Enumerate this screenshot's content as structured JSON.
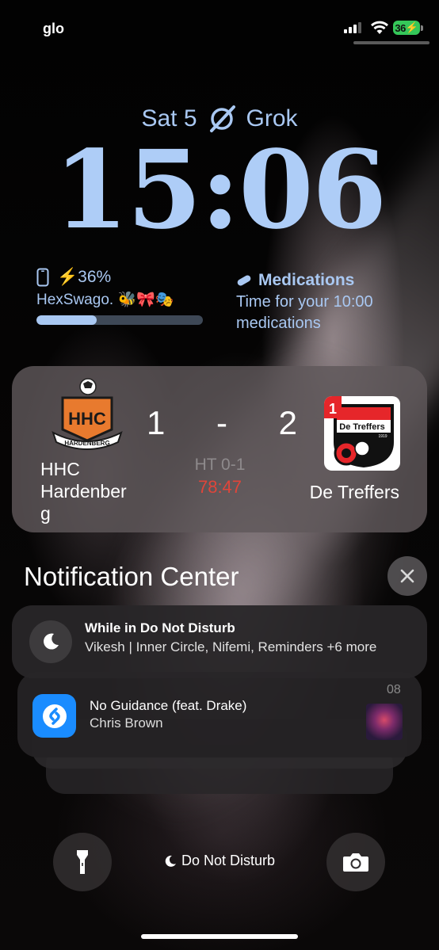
{
  "status_bar": {
    "carrier": "glo",
    "battery_level": "36",
    "battery_charging_icon": "bolt-icon"
  },
  "lock_screen": {
    "date": "Sat 5",
    "date_widget_label": "Grok",
    "time": "15:06"
  },
  "battery_widget": {
    "percent_label": "36%",
    "device_name": "HexSwago.",
    "device_emoji": "🐝🎀🎭",
    "level_fraction": 0.36
  },
  "medications_widget": {
    "title": "Medications",
    "text": "Time for your 10:00 medications"
  },
  "live_score": {
    "home_team": "HHC Hardenber g",
    "home_score": "1",
    "separator": "-",
    "away_score": "2",
    "away_team": "De Treffers",
    "half_time": "HT 0-1",
    "clock": "78:47",
    "home_logo_text": "HHC",
    "home_logo_banner": "HARDENBERG",
    "away_logo_text": "De Treffers",
    "away_logo_badge": "1",
    "away_logo_year": "1919"
  },
  "notification_center": {
    "title": "Notification Center",
    "dnd": {
      "title": "While in Do Not Disturb",
      "subtitle": "Vikesh | Inner Circle, Nifemi, Reminders +6 more"
    },
    "music": {
      "title": "No Guidance (feat. Drake)",
      "artist": "Chris Brown",
      "time": "08"
    }
  },
  "bottom": {
    "focus_label": "Do Not Disturb"
  },
  "colors": {
    "accent_blue": "#a9c8f2",
    "score_clock_red": "#e0453a",
    "battery_green": "#35c759"
  }
}
